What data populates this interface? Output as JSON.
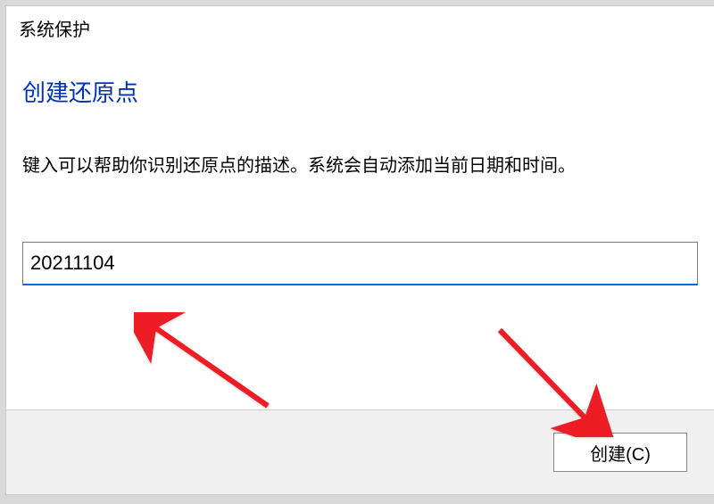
{
  "dialog": {
    "title": "系统保护",
    "heading": "创建还原点",
    "description": "键入可以帮助你识别还原点的描述。系统会自动添加当前日期和时间。",
    "input_value": "20211104",
    "create_button": "创建(C)"
  }
}
